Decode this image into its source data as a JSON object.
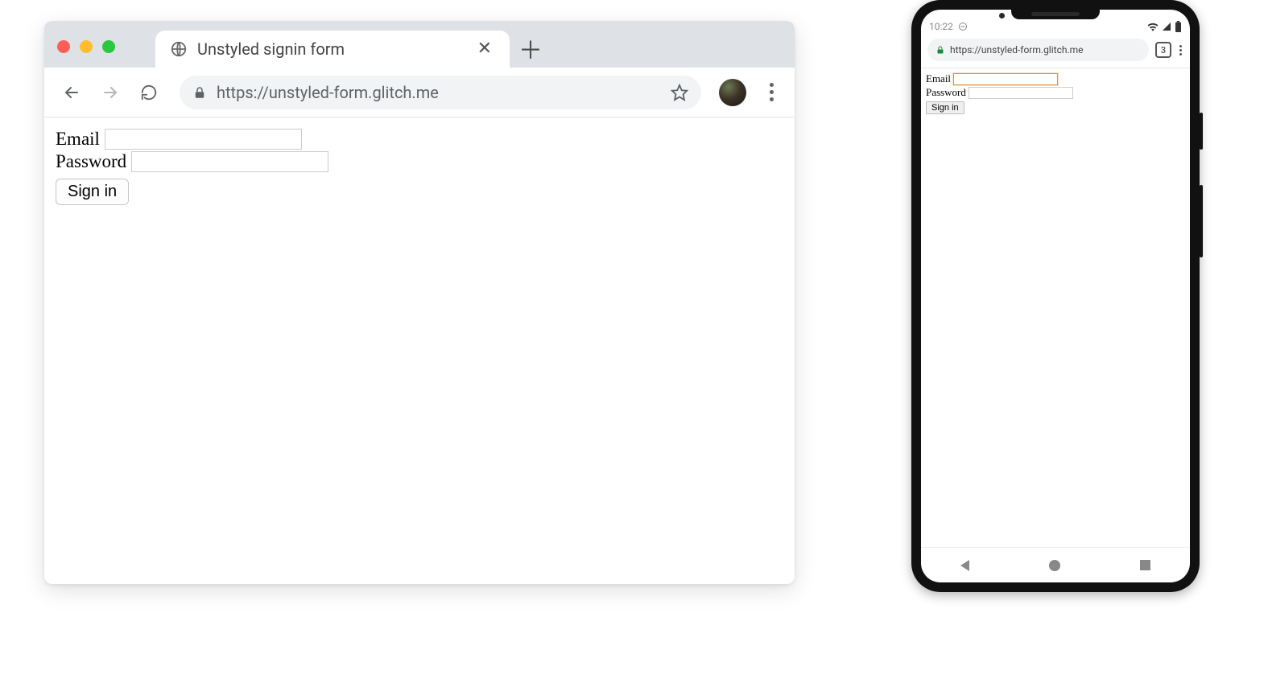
{
  "desktop": {
    "tab_title": "Unstyled signin form",
    "url": "https://unstyled-form.glitch.me",
    "form": {
      "email_label": "Email",
      "password_label": "Password",
      "submit_label": "Sign in"
    }
  },
  "mobile": {
    "status_time": "10:22",
    "url": "https://unstyled-form.glitch.me",
    "tab_count": "3",
    "form": {
      "email_label": "Email",
      "password_label": "Password",
      "submit_label": "Sign in"
    }
  }
}
